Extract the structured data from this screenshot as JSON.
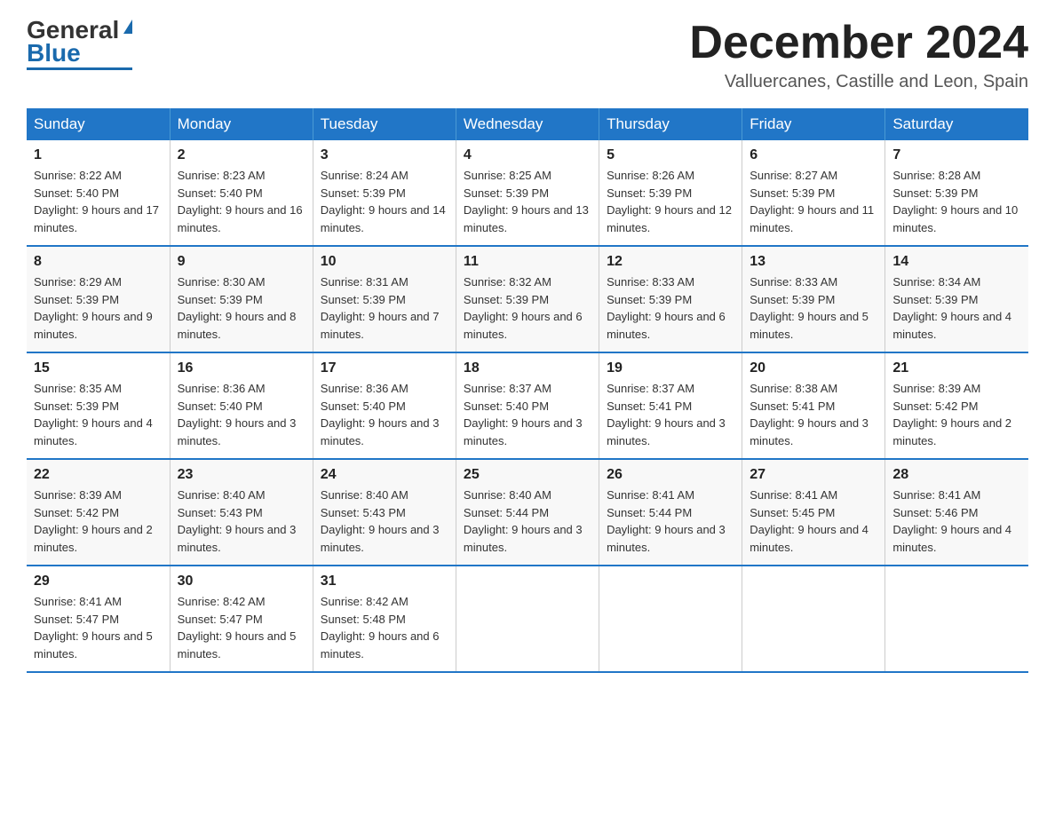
{
  "header": {
    "logo_general": "General",
    "logo_blue": "Blue",
    "month_title": "December 2024",
    "location": "Valluercanes, Castille and Leon, Spain"
  },
  "days_of_week": [
    "Sunday",
    "Monday",
    "Tuesday",
    "Wednesday",
    "Thursday",
    "Friday",
    "Saturday"
  ],
  "weeks": [
    [
      {
        "day": "1",
        "sunrise": "8:22 AM",
        "sunset": "5:40 PM",
        "daylight": "9 hours and 17 minutes."
      },
      {
        "day": "2",
        "sunrise": "8:23 AM",
        "sunset": "5:40 PM",
        "daylight": "9 hours and 16 minutes."
      },
      {
        "day": "3",
        "sunrise": "8:24 AM",
        "sunset": "5:39 PM",
        "daylight": "9 hours and 14 minutes."
      },
      {
        "day": "4",
        "sunrise": "8:25 AM",
        "sunset": "5:39 PM",
        "daylight": "9 hours and 13 minutes."
      },
      {
        "day": "5",
        "sunrise": "8:26 AM",
        "sunset": "5:39 PM",
        "daylight": "9 hours and 12 minutes."
      },
      {
        "day": "6",
        "sunrise": "8:27 AM",
        "sunset": "5:39 PM",
        "daylight": "9 hours and 11 minutes."
      },
      {
        "day": "7",
        "sunrise": "8:28 AM",
        "sunset": "5:39 PM",
        "daylight": "9 hours and 10 minutes."
      }
    ],
    [
      {
        "day": "8",
        "sunrise": "8:29 AM",
        "sunset": "5:39 PM",
        "daylight": "9 hours and 9 minutes."
      },
      {
        "day": "9",
        "sunrise": "8:30 AM",
        "sunset": "5:39 PM",
        "daylight": "9 hours and 8 minutes."
      },
      {
        "day": "10",
        "sunrise": "8:31 AM",
        "sunset": "5:39 PM",
        "daylight": "9 hours and 7 minutes."
      },
      {
        "day": "11",
        "sunrise": "8:32 AM",
        "sunset": "5:39 PM",
        "daylight": "9 hours and 6 minutes."
      },
      {
        "day": "12",
        "sunrise": "8:33 AM",
        "sunset": "5:39 PM",
        "daylight": "9 hours and 6 minutes."
      },
      {
        "day": "13",
        "sunrise": "8:33 AM",
        "sunset": "5:39 PM",
        "daylight": "9 hours and 5 minutes."
      },
      {
        "day": "14",
        "sunrise": "8:34 AM",
        "sunset": "5:39 PM",
        "daylight": "9 hours and 4 minutes."
      }
    ],
    [
      {
        "day": "15",
        "sunrise": "8:35 AM",
        "sunset": "5:39 PM",
        "daylight": "9 hours and 4 minutes."
      },
      {
        "day": "16",
        "sunrise": "8:36 AM",
        "sunset": "5:40 PM",
        "daylight": "9 hours and 3 minutes."
      },
      {
        "day": "17",
        "sunrise": "8:36 AM",
        "sunset": "5:40 PM",
        "daylight": "9 hours and 3 minutes."
      },
      {
        "day": "18",
        "sunrise": "8:37 AM",
        "sunset": "5:40 PM",
        "daylight": "9 hours and 3 minutes."
      },
      {
        "day": "19",
        "sunrise": "8:37 AM",
        "sunset": "5:41 PM",
        "daylight": "9 hours and 3 minutes."
      },
      {
        "day": "20",
        "sunrise": "8:38 AM",
        "sunset": "5:41 PM",
        "daylight": "9 hours and 3 minutes."
      },
      {
        "day": "21",
        "sunrise": "8:39 AM",
        "sunset": "5:42 PM",
        "daylight": "9 hours and 2 minutes."
      }
    ],
    [
      {
        "day": "22",
        "sunrise": "8:39 AM",
        "sunset": "5:42 PM",
        "daylight": "9 hours and 2 minutes."
      },
      {
        "day": "23",
        "sunrise": "8:40 AM",
        "sunset": "5:43 PM",
        "daylight": "9 hours and 3 minutes."
      },
      {
        "day": "24",
        "sunrise": "8:40 AM",
        "sunset": "5:43 PM",
        "daylight": "9 hours and 3 minutes."
      },
      {
        "day": "25",
        "sunrise": "8:40 AM",
        "sunset": "5:44 PM",
        "daylight": "9 hours and 3 minutes."
      },
      {
        "day": "26",
        "sunrise": "8:41 AM",
        "sunset": "5:44 PM",
        "daylight": "9 hours and 3 minutes."
      },
      {
        "day": "27",
        "sunrise": "8:41 AM",
        "sunset": "5:45 PM",
        "daylight": "9 hours and 4 minutes."
      },
      {
        "day": "28",
        "sunrise": "8:41 AM",
        "sunset": "5:46 PM",
        "daylight": "9 hours and 4 minutes."
      }
    ],
    [
      {
        "day": "29",
        "sunrise": "8:41 AM",
        "sunset": "5:47 PM",
        "daylight": "9 hours and 5 minutes."
      },
      {
        "day": "30",
        "sunrise": "8:42 AM",
        "sunset": "5:47 PM",
        "daylight": "9 hours and 5 minutes."
      },
      {
        "day": "31",
        "sunrise": "8:42 AM",
        "sunset": "5:48 PM",
        "daylight": "9 hours and 6 minutes."
      },
      null,
      null,
      null,
      null
    ]
  ]
}
